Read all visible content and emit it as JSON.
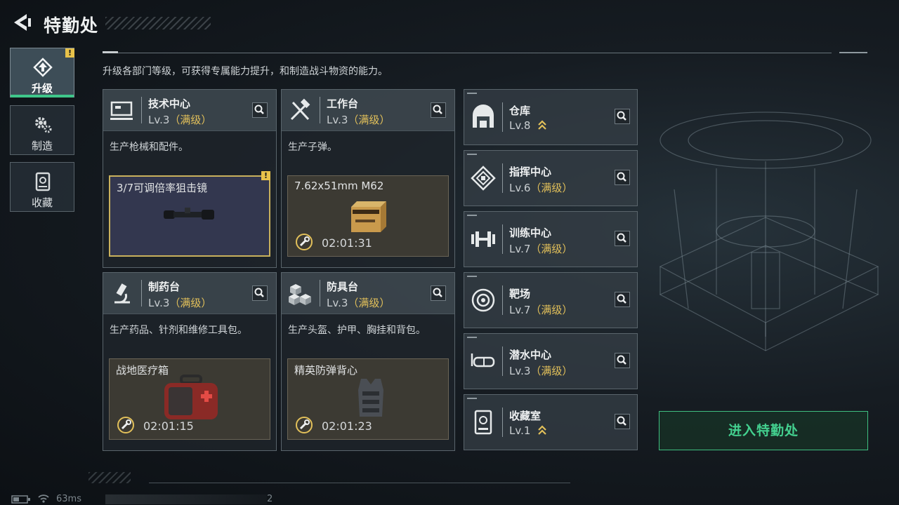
{
  "header": {
    "title": "特勤处",
    "description": "升级各部门等级，可获得专属能力提升，和制造战斗物资的能力。"
  },
  "nav": [
    {
      "label": "升级",
      "icon": "upgrade-icon",
      "active": true,
      "warning": "!"
    },
    {
      "label": "制造",
      "icon": "gear-icon",
      "active": false
    },
    {
      "label": "收藏",
      "icon": "collection-icon",
      "active": false
    }
  ],
  "cards": [
    {
      "name": "技术中心",
      "level": "Lv.3",
      "max": "（满级）",
      "icon": "monitor-icon",
      "desc": "生产枪械和配件。",
      "item": "3/7可调倍率狙击镜",
      "timer": "",
      "warning": "!"
    },
    {
      "name": "工作台",
      "level": "Lv.3",
      "max": "（满级）",
      "icon": "tools-icon",
      "desc": "生产子弹。",
      "item": "7.62x51mm M62",
      "timer": "02:01:31"
    },
    {
      "name": "制药台",
      "level": "Lv.3",
      "max": "（满级）",
      "icon": "microscope-icon",
      "desc": "生产药品、针剂和维修工具包。",
      "item": "战地医疗箱",
      "timer": "02:01:15"
    },
    {
      "name": "防具台",
      "level": "Lv.3",
      "max": "（满级）",
      "icon": "armor-cubes-icon",
      "desc": "生产头盔、护甲、胸挂和背包。",
      "item": "精英防弹背心",
      "timer": "02:01:23"
    }
  ],
  "rooms": [
    {
      "name": "仓库",
      "level": "Lv.8",
      "max": "",
      "upgradable": true,
      "icon": "warehouse-icon"
    },
    {
      "name": "指挥中心",
      "level": "Lv.6",
      "max": "（满级）",
      "upgradable": false,
      "icon": "chip-icon"
    },
    {
      "name": "训练中心",
      "level": "Lv.7",
      "max": "（满级）",
      "upgradable": false,
      "icon": "dumbbell-icon"
    },
    {
      "name": "靶场",
      "level": "Lv.7",
      "max": "（满级）",
      "upgradable": false,
      "icon": "target-icon"
    },
    {
      "name": "潜水中心",
      "level": "Lv.3",
      "max": "（满级）",
      "upgradable": false,
      "icon": "goggles-icon"
    },
    {
      "name": "收藏室",
      "level": "Lv.1",
      "max": "",
      "upgradable": true,
      "icon": "collection-room-icon"
    }
  ],
  "enter_button": "进入特勤处",
  "status_bar": {
    "ping": "63ms",
    "count": "2"
  },
  "colors": {
    "accent_green": "#43d08f",
    "gold": "#e2c05a",
    "warning": "#e8c24a"
  }
}
